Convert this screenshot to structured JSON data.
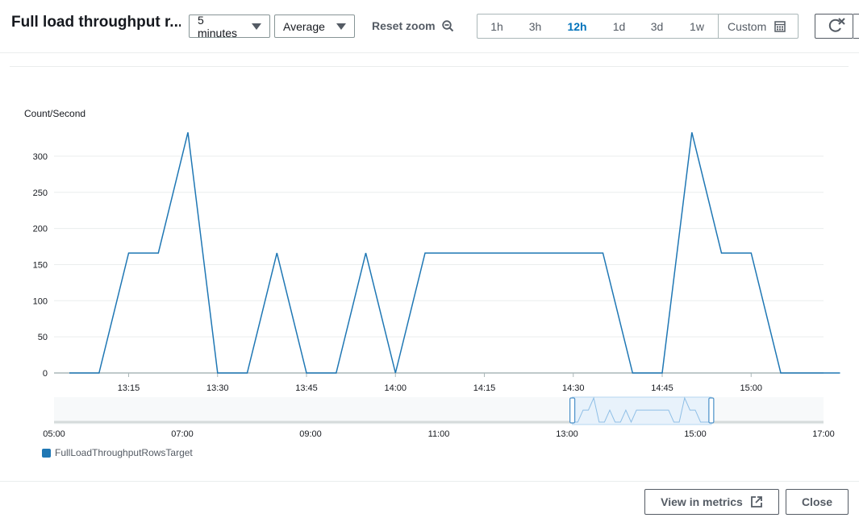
{
  "header": {
    "title": "Full load throughput r...",
    "period_select": "5 minutes",
    "stat_select": "Average",
    "reset_zoom": "Reset zoom",
    "ranges": [
      "1h",
      "3h",
      "12h",
      "1d",
      "3d",
      "1w"
    ],
    "active_range": "12h",
    "custom": "Custom"
  },
  "colors": {
    "series": "#1f77b4",
    "active": "#0073bb"
  },
  "chart_data": {
    "type": "line",
    "ylabel": "Count/Second",
    "yticks": [
      "0",
      "50",
      "100",
      "150",
      "200",
      "250",
      "300"
    ],
    "xticks": [
      "13:15",
      "13:30",
      "13:45",
      "14:00",
      "14:15",
      "14:30",
      "14:45",
      "15:00"
    ],
    "ylim": [
      0,
      300
    ],
    "grid": true,
    "legend_position": "bottom-left",
    "series": [
      {
        "name": "FullLoadThroughputRowsTarget",
        "x": [
          "13:05",
          "13:10",
          "13:15",
          "13:20",
          "13:25",
          "13:30",
          "13:35",
          "13:40",
          "13:45",
          "13:50",
          "13:55",
          "14:00",
          "14:05",
          "14:10",
          "14:15",
          "14:20",
          "14:25",
          "14:30",
          "14:35",
          "14:40",
          "14:45",
          "14:50",
          "14:55",
          "15:00",
          "15:05",
          "15:10",
          "15:15"
        ],
        "values": [
          0,
          0,
          166,
          166,
          333,
          0,
          0,
          166,
          0,
          0,
          166,
          0,
          166,
          166,
          166,
          166,
          166,
          166,
          166,
          0,
          0,
          333,
          166,
          166,
          0,
          0,
          0
        ]
      }
    ]
  },
  "navigator": {
    "xticks": [
      "05:00",
      "07:00",
      "09:00",
      "11:00",
      "13:00",
      "15:00",
      "17:00"
    ]
  },
  "footer": {
    "view_in_metrics": "View in metrics",
    "close": "Close"
  }
}
